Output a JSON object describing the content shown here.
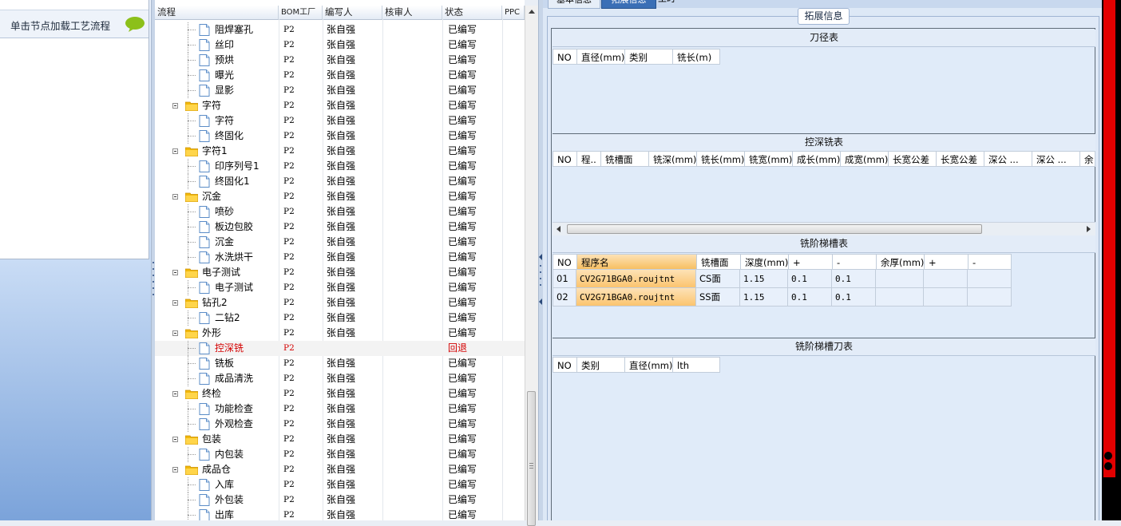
{
  "left_panel": {
    "header": "单击节点加载工艺流程",
    "icon": "speech-bubble-icon"
  },
  "tree": {
    "columns": [
      "流程",
      "BOM工厂",
      "编写人",
      "核审人",
      "状态",
      "PPC"
    ],
    "rows": [
      {
        "level": 1,
        "type": "file",
        "name": "阻焊塞孔",
        "bom": "P2",
        "author": "张自强",
        "reviewer": "",
        "status": "已编写"
      },
      {
        "level": 1,
        "type": "file",
        "name": "丝印",
        "bom": "P2",
        "author": "张自强",
        "reviewer": "",
        "status": "已编写"
      },
      {
        "level": 1,
        "type": "file",
        "name": "预烘",
        "bom": "P2",
        "author": "张自强",
        "reviewer": "",
        "status": "已编写"
      },
      {
        "level": 1,
        "type": "file",
        "name": "曝光",
        "bom": "P2",
        "author": "张自强",
        "reviewer": "",
        "status": "已编写"
      },
      {
        "level": 1,
        "type": "file",
        "name": "显影",
        "bom": "P2",
        "author": "张自强",
        "reviewer": "",
        "status": "已编写"
      },
      {
        "level": 0,
        "type": "folder",
        "name": "字符",
        "bom": "P2",
        "author": "张自强",
        "reviewer": "",
        "status": "已编写"
      },
      {
        "level": 1,
        "type": "file",
        "name": "字符",
        "bom": "P2",
        "author": "张自强",
        "reviewer": "",
        "status": "已编写"
      },
      {
        "level": 1,
        "type": "file",
        "name": "终固化",
        "bom": "P2",
        "author": "张自强",
        "reviewer": "",
        "status": "已编写"
      },
      {
        "level": 0,
        "type": "folder",
        "name": "字符1",
        "bom": "P2",
        "author": "张自强",
        "reviewer": "",
        "status": "已编写"
      },
      {
        "level": 1,
        "type": "file",
        "name": "印序列号1",
        "bom": "P2",
        "author": "张自强",
        "reviewer": "",
        "status": "已编写"
      },
      {
        "level": 1,
        "type": "file",
        "name": "终固化1",
        "bom": "P2",
        "author": "张自强",
        "reviewer": "",
        "status": "已编写"
      },
      {
        "level": 0,
        "type": "folder",
        "name": "沉金",
        "bom": "P2",
        "author": "张自强",
        "reviewer": "",
        "status": "已编写"
      },
      {
        "level": 1,
        "type": "file",
        "name": "喷砂",
        "bom": "P2",
        "author": "张自强",
        "reviewer": "",
        "status": "已编写"
      },
      {
        "level": 1,
        "type": "file",
        "name": "板边包胶",
        "bom": "P2",
        "author": "张自强",
        "reviewer": "",
        "status": "已编写"
      },
      {
        "level": 1,
        "type": "file",
        "name": "沉金",
        "bom": "P2",
        "author": "张自强",
        "reviewer": "",
        "status": "已编写"
      },
      {
        "level": 1,
        "type": "file",
        "name": "水洗烘干",
        "bom": "P2",
        "author": "张自强",
        "reviewer": "",
        "status": "已编写"
      },
      {
        "level": 0,
        "type": "folder",
        "name": "电子测试",
        "bom": "P2",
        "author": "张自强",
        "reviewer": "",
        "status": "已编写"
      },
      {
        "level": 1,
        "type": "file",
        "name": "电子测试",
        "bom": "P2",
        "author": "张自强",
        "reviewer": "",
        "status": "已编写"
      },
      {
        "level": 0,
        "type": "folder",
        "name": "钻孔2",
        "bom": "P2",
        "author": "张自强",
        "reviewer": "",
        "status": "已编写"
      },
      {
        "level": 1,
        "type": "file",
        "name": "二钻2",
        "bom": "P2",
        "author": "张自强",
        "reviewer": "",
        "status": "已编写"
      },
      {
        "level": 0,
        "type": "folder",
        "name": "外形",
        "bom": "P2",
        "author": "张自强",
        "reviewer": "",
        "status": "已编写"
      },
      {
        "level": 1,
        "type": "file",
        "name": "控深铣",
        "bom": "P2",
        "author": "",
        "reviewer": "",
        "status": "回退",
        "highlight": true
      },
      {
        "level": 1,
        "type": "file",
        "name": "铣板",
        "bom": "P2",
        "author": "张自强",
        "reviewer": "",
        "status": "已编写"
      },
      {
        "level": 1,
        "type": "file",
        "name": "成品清洗",
        "bom": "P2",
        "author": "张自强",
        "reviewer": "",
        "status": "已编写"
      },
      {
        "level": 0,
        "type": "folder",
        "name": "终检",
        "bom": "P2",
        "author": "张自强",
        "reviewer": "",
        "status": "已编写"
      },
      {
        "level": 1,
        "type": "file",
        "name": "功能检查",
        "bom": "P2",
        "author": "张自强",
        "reviewer": "",
        "status": "已编写"
      },
      {
        "level": 1,
        "type": "file",
        "name": "外观检查",
        "bom": "P2",
        "author": "张自强",
        "reviewer": "",
        "status": "已编写"
      },
      {
        "level": 0,
        "type": "folder",
        "name": "包装",
        "bom": "P2",
        "author": "张自强",
        "reviewer": "",
        "status": "已编写"
      },
      {
        "level": 1,
        "type": "file",
        "name": "内包装",
        "bom": "P2",
        "author": "张自强",
        "reviewer": "",
        "status": "已编写"
      },
      {
        "level": 0,
        "type": "folder",
        "name": "成品仓",
        "bom": "P2",
        "author": "张自强",
        "reviewer": "",
        "status": "已编写"
      },
      {
        "level": 1,
        "type": "file",
        "name": "入库",
        "bom": "P2",
        "author": "张自强",
        "reviewer": "",
        "status": "已编写"
      },
      {
        "level": 1,
        "type": "file",
        "name": "外包装",
        "bom": "P2",
        "author": "张自强",
        "reviewer": "",
        "status": "已编写"
      },
      {
        "level": 1,
        "type": "file",
        "name": "出库",
        "bom": "P2",
        "author": "张自强",
        "reviewer": "",
        "status": "已编写"
      }
    ]
  },
  "right_panel": {
    "tabs": [
      "基本信息",
      "拓展信息",
      "工时"
    ],
    "active_tab": 1,
    "group_title": "拓展信息",
    "cutter_table": {
      "title": "刀径表",
      "columns": [
        "NO",
        "直径(mm)",
        "类别",
        "铣长(m)"
      ]
    },
    "depth_table": {
      "title": "控深铣表",
      "columns": [
        "NO",
        "程..",
        "铣槽面",
        "铣深(mm)",
        "铣长(mm)",
        "铣宽(mm)",
        "成长(mm)",
        "成宽(mm)",
        "长宽公差",
        "长宽公差",
        "深公 ...",
        "深公 ...",
        "余"
      ]
    },
    "step_table": {
      "title": "铣阶梯槽表",
      "columns": [
        "NO",
        "程序名",
        "铣槽面",
        "深度(mm)",
        "+",
        "-",
        "余厚(mm)",
        "+",
        "-"
      ],
      "rows": [
        [
          "01",
          "CV2G71BGA0.roujtnt",
          "CS面",
          "1.15",
          "0.1",
          "0.1",
          "",
          "",
          ""
        ],
        [
          "02",
          "CV2G71BGA0.roujtnt",
          "SS面",
          "1.15",
          "0.1",
          "0.1",
          "",
          "",
          ""
        ]
      ]
    },
    "step_cutter_table": {
      "title": "铣阶梯槽刀表",
      "columns": [
        "NO",
        "类别",
        "直径(mm)",
        "lth"
      ]
    }
  },
  "colors": {
    "accent": "#3a6fb6",
    "highlight_orange": "#fbc46f",
    "status_back_red": "#d40000",
    "side_bar_red": "#e20000"
  }
}
